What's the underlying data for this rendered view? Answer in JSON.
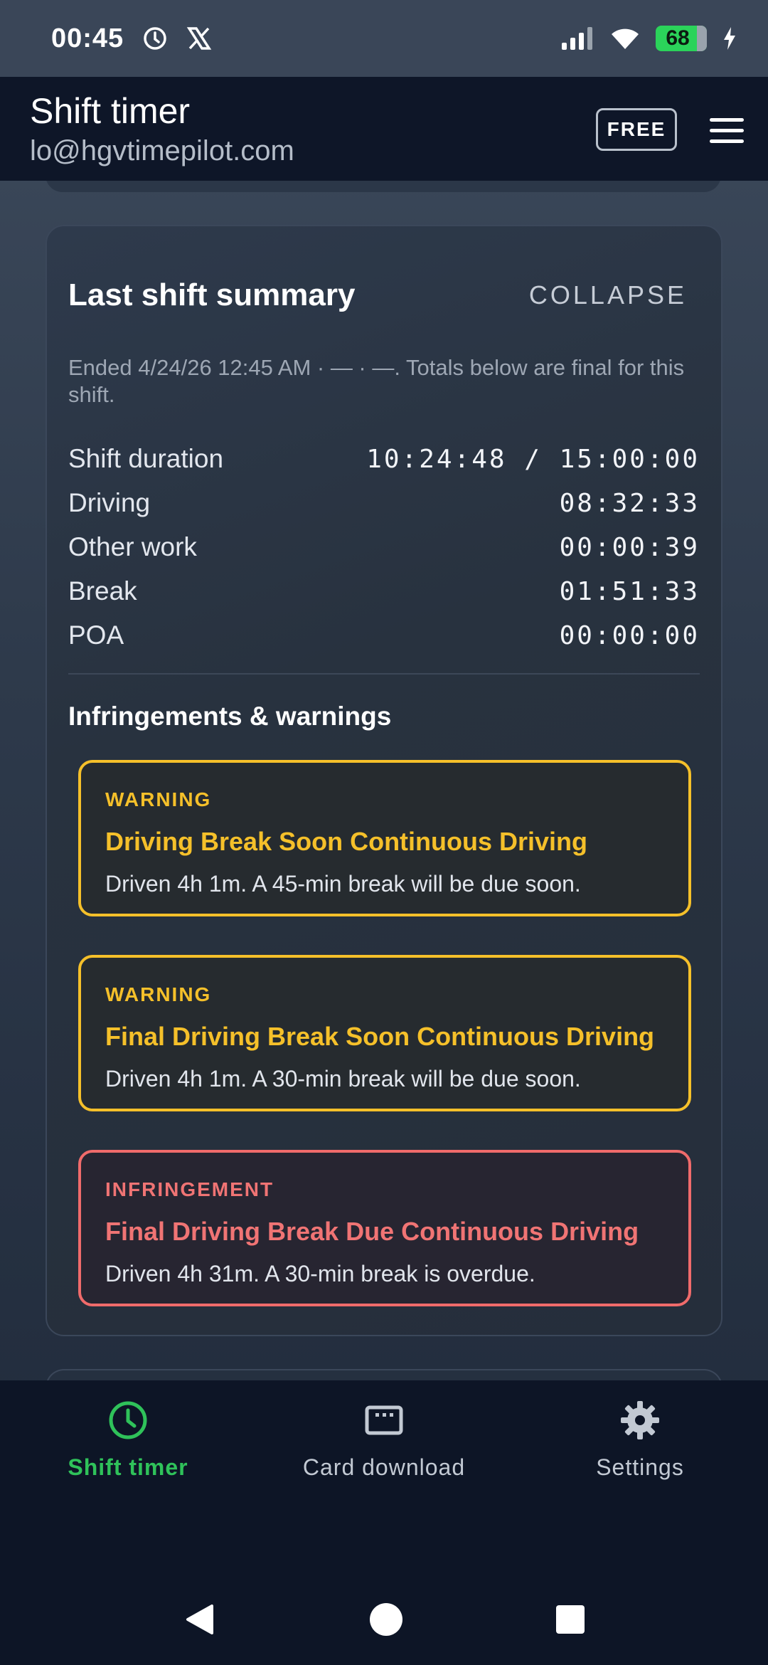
{
  "status_bar": {
    "time": "00:45",
    "battery": "68"
  },
  "header": {
    "title": "Shift timer",
    "email": "lo@hgvtimepilot.com",
    "plan_badge": "FREE"
  },
  "summary": {
    "title": "Last shift summary",
    "collapse_label": "COLLAPSE",
    "note": "Ended 4/24/26 12:45 AM · — · —. Totals below are final for this shift.",
    "totals": [
      {
        "label": "Shift duration",
        "value": "10:24:48 / 15:00:00"
      },
      {
        "label": "Driving",
        "value": "08:32:33"
      },
      {
        "label": "Other work",
        "value": "00:00:39"
      },
      {
        "label": "Break",
        "value": "01:51:33"
      },
      {
        "label": "POA",
        "value": "00:00:00"
      }
    ],
    "section_title": "Infringements & warnings",
    "alerts": [
      {
        "kind": "WARNING",
        "title": "Driving Break Soon Continuous Driving",
        "desc": "Driven 4h 1m. A 45-min break will be due soon."
      },
      {
        "kind": "WARNING",
        "title": "Final Driving Break Soon Continuous Driving",
        "desc": "Driven 4h 1m. A 30-min break will be due soon."
      },
      {
        "kind": "INFRINGEMENT",
        "title": "Final Driving Break Due Continuous Driving",
        "desc": "Driven 4h 31m. A 30-min break is overdue."
      }
    ]
  },
  "bottom_nav": {
    "items": [
      {
        "label": "Shift timer",
        "icon": "clock-icon"
      },
      {
        "label": "Card download",
        "icon": "card-reader-icon"
      },
      {
        "label": "Settings",
        "icon": "gear-icon"
      }
    ]
  },
  "colors": {
    "warning": "#f5c02a",
    "infringement": "#f06b6b",
    "active_nav": "#2fc25a",
    "battery": "#2bd35a"
  }
}
